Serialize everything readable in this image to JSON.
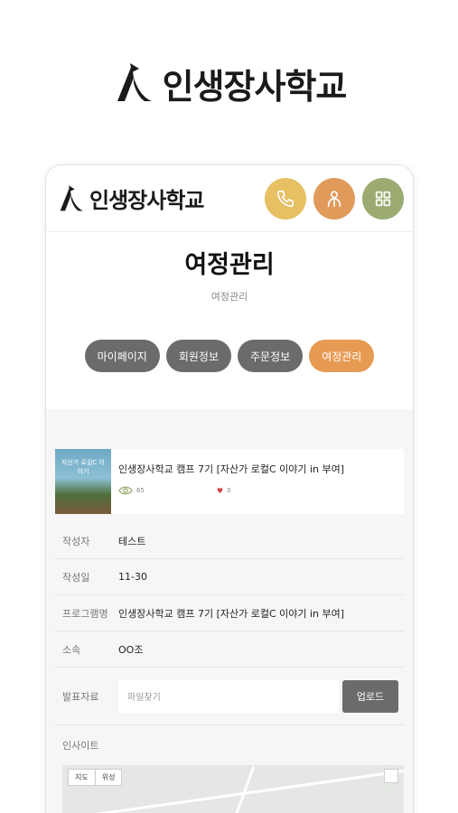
{
  "brand": {
    "name": "인생장사학교"
  },
  "header": {
    "brand_name": "인생장사학교",
    "buttons": [
      {
        "icon": "phone-icon",
        "color": "#e6c063"
      },
      {
        "icon": "user-icon",
        "color": "#e09a5a"
      },
      {
        "icon": "grid-icon",
        "color": "#9bab72"
      }
    ]
  },
  "page": {
    "title": "여정관리",
    "breadcrumb": "여정관리"
  },
  "tabs": [
    {
      "label": "마이페이지",
      "active": false
    },
    {
      "label": "회원정보",
      "active": false
    },
    {
      "label": "주문정보",
      "active": false
    },
    {
      "label": "여정관리",
      "active": true
    }
  ],
  "post": {
    "title": "인생장사학교 캠프 7기 [자산가 로컬C 이야기 in 부여]",
    "views": "65",
    "likes": "0",
    "thumb_text": "자산가 로컬C 이야기"
  },
  "form": {
    "author_label": "작성자",
    "author_value": "테스트",
    "date_label": "작성일",
    "date_value": "11-30",
    "program_label": "프로그램명",
    "program_value": "인생장사학교 캠프 7기 [자산가 로컬C 이야기 in 부여]",
    "affiliation_label": "소속",
    "affiliation_value": "OO조",
    "file_label": "발표자료",
    "file_placeholder": "파일찾기",
    "upload_label": "업로드",
    "insight_label": "인사이트"
  },
  "map": {
    "tab_map": "지도",
    "tab_satellite": "위성"
  },
  "colors": {
    "accent": "#e79a52",
    "tab_default": "#6b6b6b"
  }
}
